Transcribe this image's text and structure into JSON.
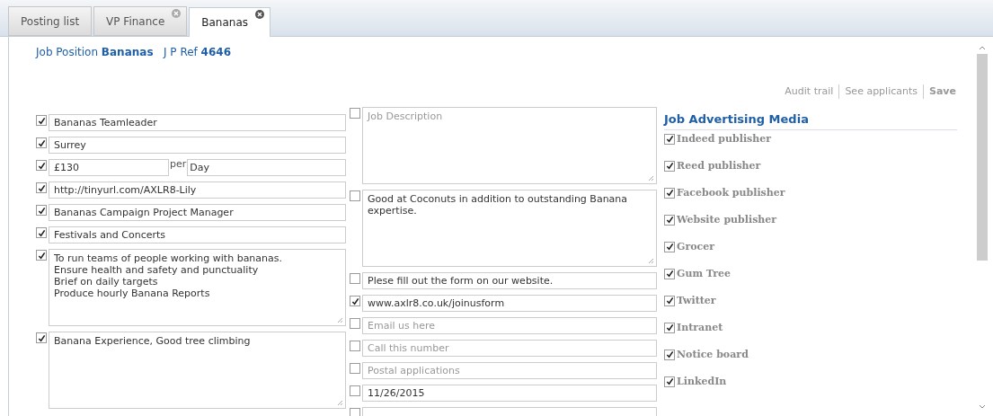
{
  "tabs": [
    {
      "label": "Posting list",
      "selected": false,
      "closable": false
    },
    {
      "label": "VP Finance",
      "selected": false,
      "closable": true
    },
    {
      "label": "Bananas",
      "selected": true,
      "closable": true
    }
  ],
  "header": "Job Position **Bananas**   J P Ref **4646**",
  "actions": [
    {
      "label": "Audit trail",
      "primary": false
    },
    {
      "label": "See applicants",
      "primary": false
    },
    {
      "label": "Save",
      "primary": true
    }
  ],
  "left_fields": [
    {
      "kind": "input",
      "checked": true,
      "value": "Bananas Teamleader"
    },
    {
      "kind": "input",
      "checked": true,
      "value": "Surrey"
    },
    {
      "kind": "salary",
      "checked": true,
      "value": "£130",
      "per": "per",
      "unit": "Day"
    },
    {
      "kind": "input",
      "checked": true,
      "value": "http://tinyurl.com/AXLR8-Lily"
    },
    {
      "kind": "input",
      "checked": true,
      "value": "Bananas Campaign Project Manager"
    },
    {
      "kind": "input",
      "checked": true,
      "value": "Festivals and Concerts"
    },
    {
      "kind": "textarea",
      "checked": true,
      "value": "To run teams of people working with bananas.\nEnsure health and safety and punctuality\nBrief on daily targets\nProduce hourly Banana Reports"
    },
    {
      "kind": "textarea",
      "checked": true,
      "value": "Banana Experience, Good tree climbing"
    }
  ],
  "middle_fields": [
    {
      "kind": "textarea",
      "checked": false,
      "placeholder": "Job Description"
    },
    {
      "kind": "textarea",
      "checked": false,
      "value": "Good at Coconuts in addition to outstanding Banana expertise."
    },
    {
      "kind": "input",
      "checked": false,
      "value": "Plese fill out the form on our website."
    },
    {
      "kind": "input",
      "checked": true,
      "value": "www.axlr8.co.uk/joinusform"
    },
    {
      "kind": "input",
      "checked": false,
      "placeholder": "Email us here"
    },
    {
      "kind": "input",
      "checked": false,
      "placeholder": "Call this number"
    },
    {
      "kind": "input",
      "checked": false,
      "placeholder": "Postal applications"
    },
    {
      "kind": "input",
      "checked": false,
      "value": "11/26/2015"
    },
    {
      "kind": "input",
      "checked": false
    }
  ],
  "media": {
    "title": "Job Advertising Media",
    "items": [
      {
        "label": "Indeed publisher",
        "checked": true
      },
      {
        "label": "Reed publisher",
        "checked": true
      },
      {
        "label": "Facebook publisher",
        "checked": true
      },
      {
        "label": "Website publisher",
        "checked": true
      },
      {
        "label": "Grocer",
        "checked": true
      },
      {
        "label": "Gum Tree",
        "checked": true
      },
      {
        "label": "Twitter",
        "checked": true
      },
      {
        "label": "Intranet",
        "checked": true
      },
      {
        "label": "Notice board",
        "checked": true
      },
      {
        "label": "LinkedIn",
        "checked": true
      }
    ]
  }
}
